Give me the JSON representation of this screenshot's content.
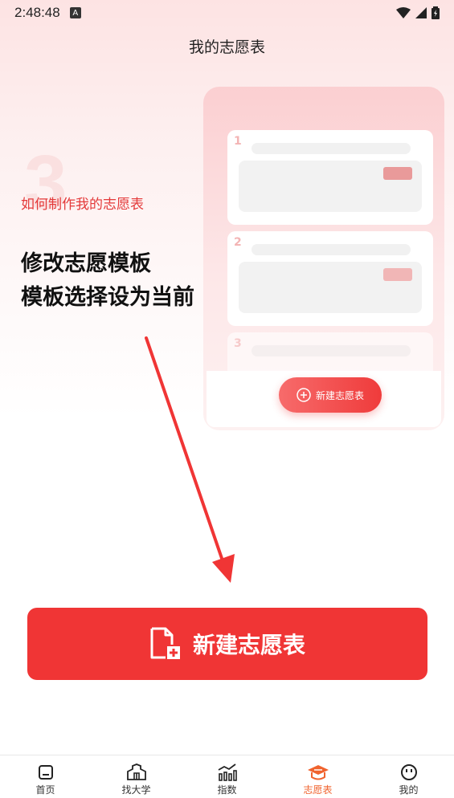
{
  "status": {
    "time": "2:48:48",
    "a_badge": "A"
  },
  "page_title": "我的志愿表",
  "guide": {
    "step_number": "3",
    "how_label": "如何制作我的志愿表",
    "line1": "修改志愿模板",
    "line2": "模板选择设为当前"
  },
  "preview": {
    "cards": [
      {
        "num": "1",
        "tag_color": "#e99a9a"
      },
      {
        "num": "2",
        "tag_color": "#f1b6b6"
      },
      {
        "num": "3"
      }
    ],
    "new_button_label": "新建志愿表"
  },
  "create_button_label": "新建志愿表",
  "nav": {
    "items": [
      {
        "label": "首页",
        "icon": "home-icon"
      },
      {
        "label": "找大学",
        "icon": "university-icon"
      },
      {
        "label": "指数",
        "icon": "chart-icon"
      },
      {
        "label": "志愿表",
        "icon": "graduation-cap-icon",
        "active": true
      },
      {
        "label": "我的",
        "icon": "profile-face-icon"
      }
    ]
  },
  "colors": {
    "accent": "#f03535",
    "nav_active": "#f0632e"
  }
}
